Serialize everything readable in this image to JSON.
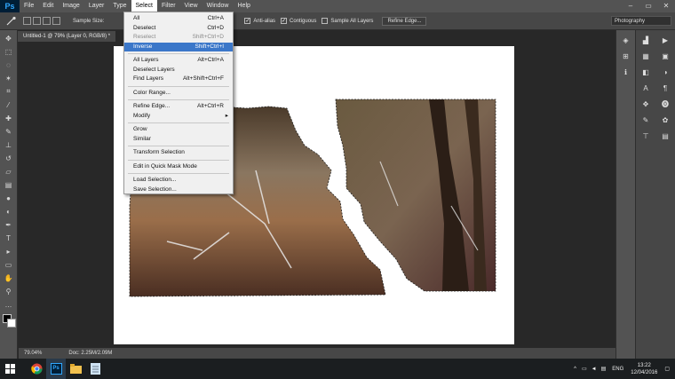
{
  "app": {
    "logo": "Ps",
    "menu": [
      "File",
      "Edit",
      "Image",
      "Layer",
      "Type",
      "Select",
      "Filter",
      "View",
      "Window",
      "Help"
    ],
    "window_controls": [
      "–",
      "▭",
      "✕"
    ]
  },
  "options": {
    "sample_size_label": "Sample Size:",
    "anti_alias": "Anti-alias",
    "contiguous": "Contiguous",
    "sample_all_layers": "Sample All Layers",
    "refine_edge": "Refine Edge...",
    "workspace": "Photography"
  },
  "document": {
    "tab": "Untitled-1 @ 79% (Layer 0, RGB/8) *",
    "zoom": "79.04%",
    "doc_size": "Doc: 2.25M/2.09M"
  },
  "select_menu": {
    "items": [
      {
        "label": "All",
        "shortcut": "Ctrl+A"
      },
      {
        "label": "Deselect",
        "shortcut": "Ctrl+D"
      },
      {
        "label": "Reselect",
        "shortcut": "Shift+Ctrl+D"
      },
      {
        "label": "Inverse",
        "shortcut": "Shift+Ctrl+I"
      },
      {
        "label": "All Layers",
        "shortcut": "Alt+Ctrl+A"
      },
      {
        "label": "Deselect Layers",
        "shortcut": ""
      },
      {
        "label": "Find Layers",
        "shortcut": "Alt+Shift+Ctrl+F"
      },
      {
        "label": "Color Range...",
        "shortcut": ""
      },
      {
        "label": "Refine Edge...",
        "shortcut": "Alt+Ctrl+R"
      },
      {
        "label": "Modify",
        "shortcut": ""
      },
      {
        "label": "Grow",
        "shortcut": ""
      },
      {
        "label": "Similar",
        "shortcut": ""
      },
      {
        "label": "Transform Selection",
        "shortcut": ""
      },
      {
        "label": "Edit in Quick Mask Mode",
        "shortcut": ""
      },
      {
        "label": "Load Selection...",
        "shortcut": ""
      },
      {
        "label": "Save Selection...",
        "shortcut": ""
      }
    ],
    "highlight_color": "#3b77c9"
  },
  "taskbar": {
    "language": "ENG",
    "time": "13:22",
    "date": "12/04/2016"
  }
}
